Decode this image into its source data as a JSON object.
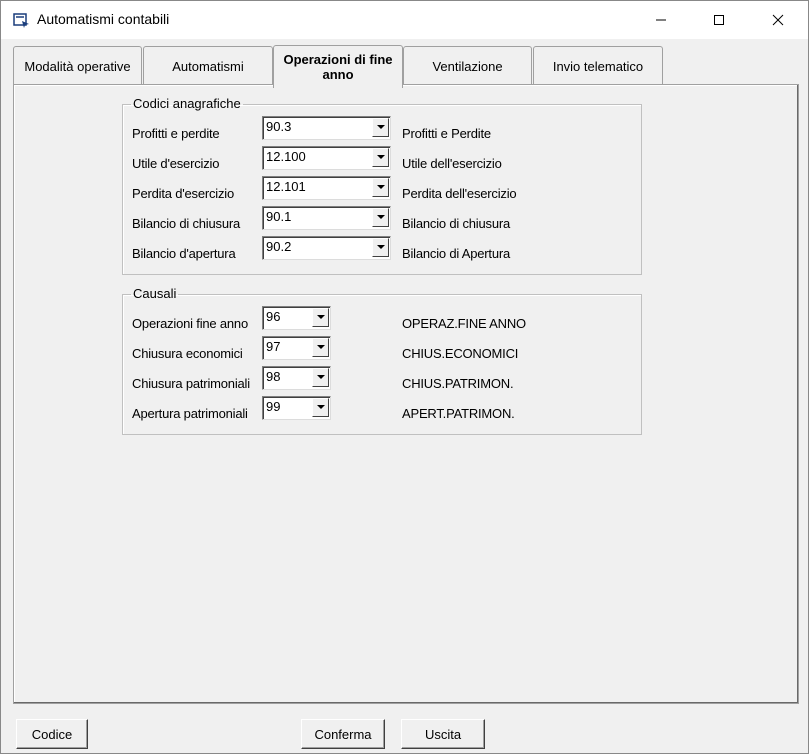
{
  "window": {
    "title": "Automatismi contabili"
  },
  "tabs": [
    {
      "label": "Modalità operative"
    },
    {
      "label": "Automatismi"
    },
    {
      "label": "Operazioni di fine anno",
      "active": true
    },
    {
      "label": "Ventilazione"
    },
    {
      "label": "Invio telematico"
    }
  ],
  "codici": {
    "legend": "Codici anagrafiche",
    "rows": [
      {
        "label": "Profitti e perdite",
        "value": "90.3",
        "description": "Profitti e Perdite"
      },
      {
        "label": "Utile d'esercizio",
        "value": "12.100",
        "description": "Utile dell'esercizio"
      },
      {
        "label": "Perdita d'esercizio",
        "value": "12.101",
        "description": "Perdita dell'esercizio"
      },
      {
        "label": "Bilancio di chiusura",
        "value": "90.1",
        "description": "Bilancio di chiusura"
      },
      {
        "label": "Bilancio d'apertura",
        "value": "90.2",
        "description": "Bilancio di Apertura"
      }
    ]
  },
  "causali": {
    "legend": "Causali",
    "rows": [
      {
        "label": "Operazioni fine anno",
        "value": "96",
        "description": "OPERAZ.FINE ANNO"
      },
      {
        "label": "Chiusura economici",
        "value": "97",
        "description": "CHIUS.ECONOMICI"
      },
      {
        "label": "Chiusura patrimoniali",
        "value": "98",
        "description": "CHIUS.PATRIMON."
      },
      {
        "label": "Apertura patrimoniali",
        "value": "99",
        "description": "APERT.PATRIMON."
      }
    ]
  },
  "buttons": {
    "codice": "Codice",
    "conferma": "Conferma",
    "uscita": "Uscita"
  }
}
